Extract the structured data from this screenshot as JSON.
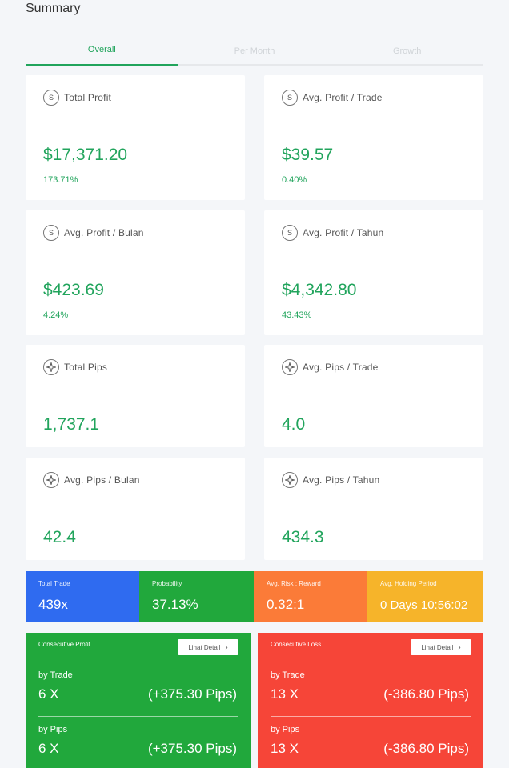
{
  "page": {
    "title": "Summary"
  },
  "tabs": [
    {
      "label": "Overall",
      "active": true
    },
    {
      "label": "Per Month",
      "active": false
    },
    {
      "label": "Growth",
      "active": false
    }
  ],
  "cards": {
    "total_profit": {
      "label": "Total Profit",
      "value": "$17,371.20",
      "pct": "173.71%",
      "icon": "dollar-icon"
    },
    "avg_profit_trade": {
      "label": "Avg. Profit / Trade",
      "value": "$39.57",
      "pct": "0.40%",
      "icon": "dollar-icon"
    },
    "avg_profit_bulan": {
      "label": "Avg. Profit / Bulan",
      "value": "$423.69",
      "pct": "4.24%",
      "icon": "dollar-icon"
    },
    "avg_profit_tahun": {
      "label": "Avg. Profit / Tahun",
      "value": "$4,342.80",
      "pct": "43.43%",
      "icon": "dollar-icon"
    },
    "total_pips": {
      "label": "Total Pips",
      "value": "1,737.1",
      "icon": "sparkle-icon"
    },
    "avg_pips_trade": {
      "label": "Avg. Pips / Trade",
      "value": "4.0",
      "icon": "sparkle-icon"
    },
    "avg_pips_bulan": {
      "label": "Avg. Pips / Bulan",
      "value": "42.4",
      "icon": "sparkle-icon"
    },
    "avg_pips_tahun": {
      "label": "Avg. Pips / Tahun",
      "value": "434.3",
      "icon": "sparkle-icon"
    }
  },
  "stats": {
    "total_trade": {
      "label": "Total Trade",
      "value": "439x",
      "color": "#2f6bf0"
    },
    "probability": {
      "label": "Probability",
      "value": "37.13%",
      "color": "#21a83c"
    },
    "risk_reward": {
      "label": "Avg. Risk : Reward",
      "value": "0.32:1",
      "color": "#fb7b38"
    },
    "holding": {
      "label": "Avg. Holding Period",
      "value": "0 Days 10:56:02",
      "color": "#f6b42a"
    }
  },
  "consecutive": {
    "profit": {
      "title": "Consecutive Profit",
      "button": "Lihat Detail",
      "color": "#21a83c",
      "by_trade_label": "by Trade",
      "by_trade_count": "6 X",
      "by_trade_pips": "(+375.30 Pips)",
      "by_pips_label": "by Pips",
      "by_pips_count": "6 X",
      "by_pips_pips": "(+375.30 Pips)"
    },
    "loss": {
      "title": "Consecutive Loss",
      "button": "Lihat Detail",
      "color": "#f64538",
      "by_trade_label": "by Trade",
      "by_trade_count": "13 X",
      "by_trade_pips": "(-386.80 Pips)",
      "by_pips_label": "by Pips",
      "by_pips_count": "13 X",
      "by_pips_pips": "(-386.80 Pips)"
    }
  },
  "colors": {
    "accent": "#21a45c"
  }
}
